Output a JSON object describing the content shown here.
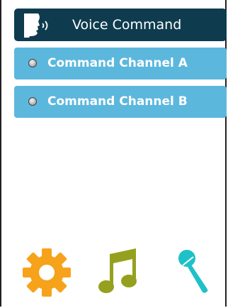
{
  "header": {
    "title": "Voice Command",
    "icon": "voice-head-icon"
  },
  "channels": [
    {
      "label": "Command Channel A",
      "icon": "radio-icon"
    },
    {
      "label": "Command Channel B",
      "icon": "radio-icon"
    }
  ],
  "toolbar": [
    {
      "name": "settings",
      "icon": "gear-icon",
      "color": "#f7a21b"
    },
    {
      "name": "music",
      "icon": "music-note-icon",
      "color": "#95a11e"
    },
    {
      "name": "microphone",
      "icon": "microphone-icon",
      "color": "#1fc1c8"
    }
  ],
  "colors": {
    "header": "#0e3c4e",
    "channel": "#5cb7dd"
  }
}
